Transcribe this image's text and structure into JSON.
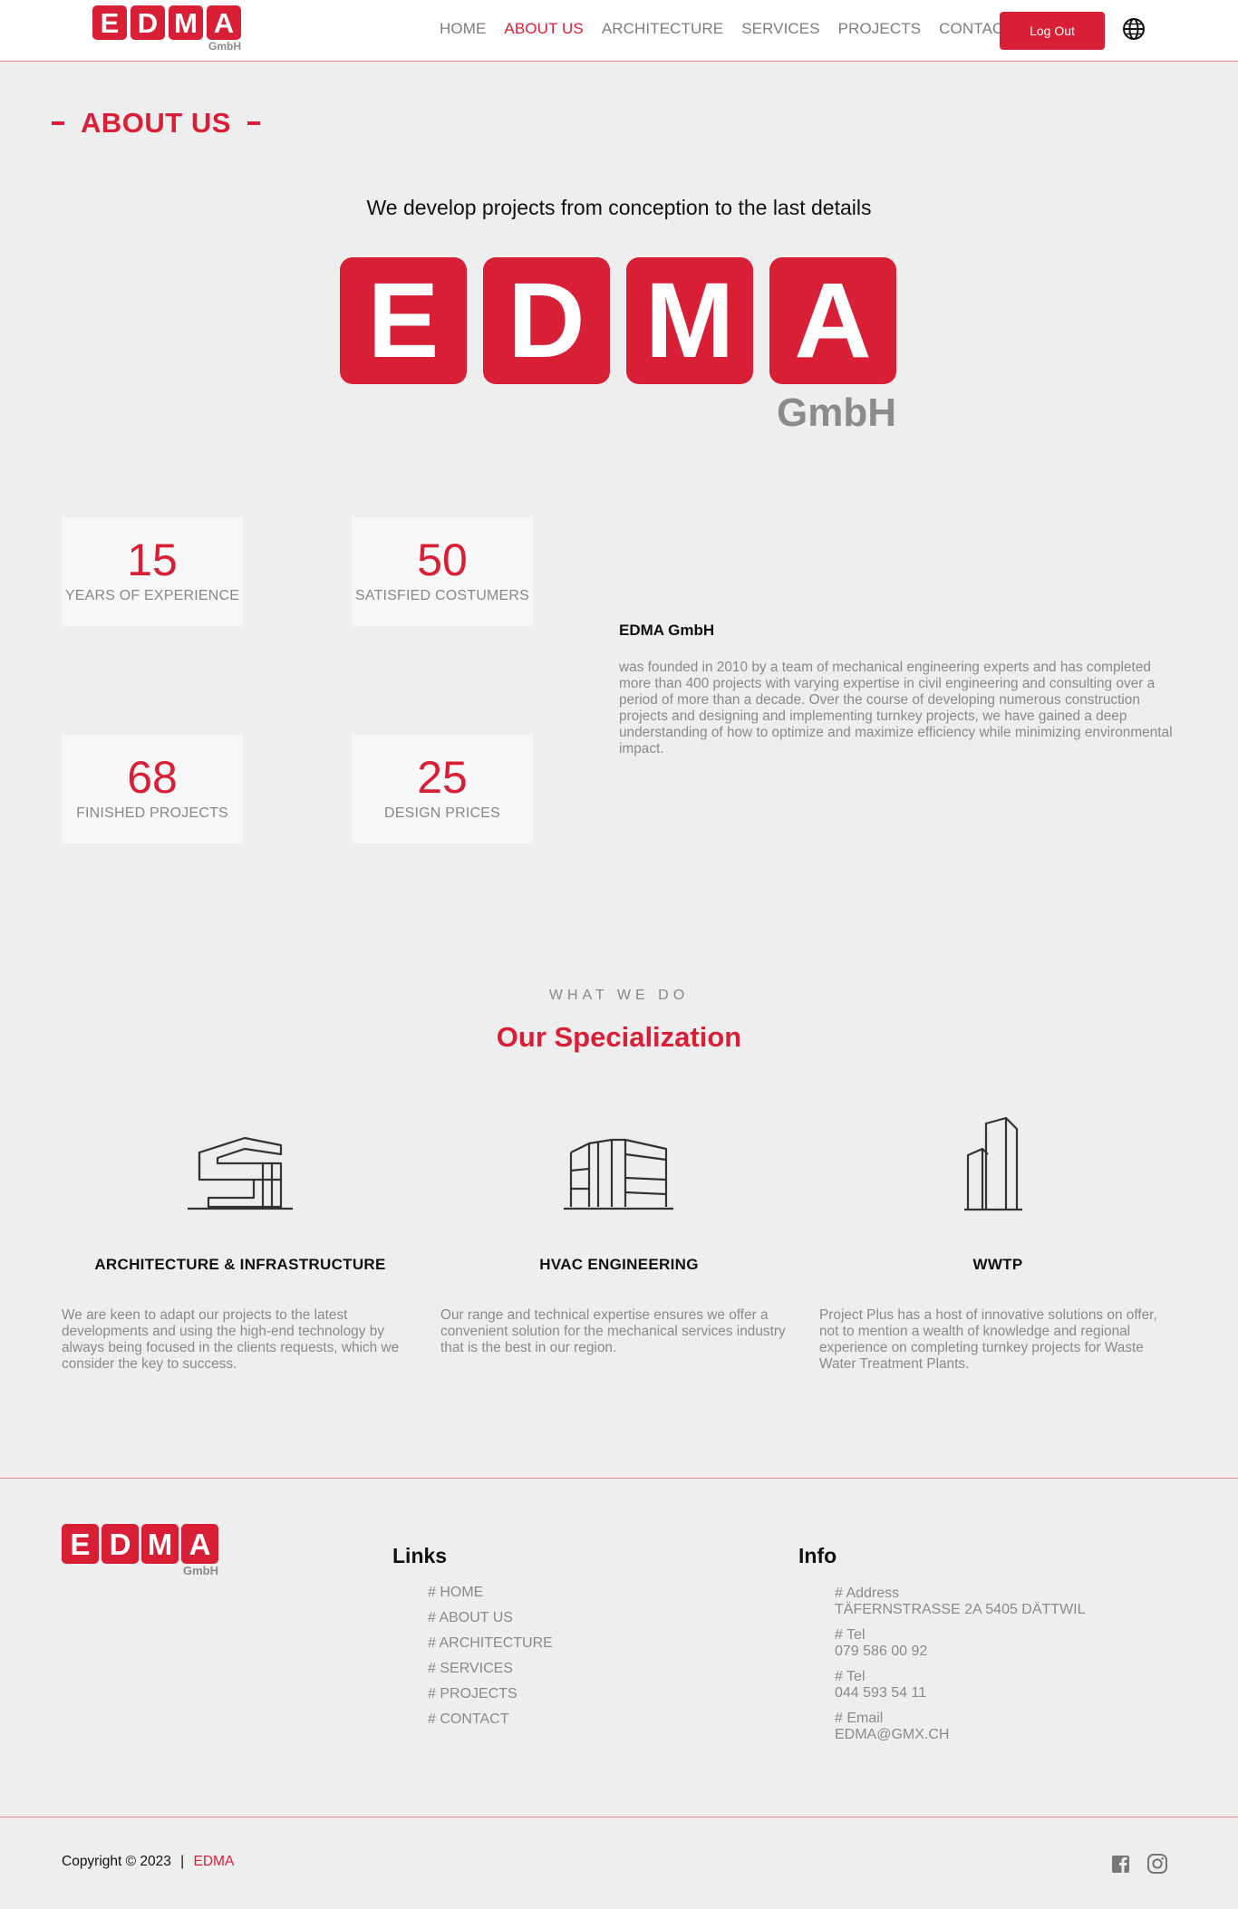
{
  "brand": {
    "letters": [
      "E",
      "D",
      "M",
      "A"
    ],
    "suffix": "GmbH",
    "accent": "#d81f35",
    "gray": "#8b8b8b"
  },
  "nav": {
    "items": [
      "HOME",
      "ABOUT US",
      "ARCHITECTURE",
      "SERVICES",
      "PROJECTS",
      "CONTACT"
    ],
    "active": "ABOUT US",
    "logout_label": "Log Out",
    "language_icon": "globe-icon"
  },
  "about": {
    "title": "ABOUT US",
    "tagline": "We develop projects from conception to the last details"
  },
  "stats": [
    {
      "value": "15",
      "label": "YEARS OF EXPERIENCE"
    },
    {
      "value": "50",
      "label": "SATISFIED COSTUMERS"
    },
    {
      "value": "68",
      "label": "FINISHED PROJECTS"
    },
    {
      "value": "25",
      "label": "DESIGN PRICES"
    }
  ],
  "company": {
    "name": "EDMA GmbH",
    "description": "was founded in 2010 by a team of mechanical engineering experts and has completed more than 400 projects with varying expertise in civil engineering and consulting over a period of more than a decade. Over the course of developing numerous construction projects and designing and implementing turnkey projects, we have gained a deep understanding of how to optimize and maximize efficiency while minimizing environmental impact."
  },
  "specialization": {
    "eyebrow": "WHAT WE DO",
    "title": "Our Specialization",
    "items": [
      {
        "icon": "building-infrastructure-icon",
        "title": "ARCHITECTURE & INFRASTRUCTURE",
        "text": "We are keen to adapt our projects to the latest developments and using the high-end technology by always being focused in the clients requests, which we consider the key to success."
      },
      {
        "icon": "hvac-building-icon",
        "title": "HVAC ENGINEERING",
        "text": "Our range and technical expertise ensures we offer a convenient solution for the mechanical services industry that is the best in our region."
      },
      {
        "icon": "towers-icon",
        "title": "WWTP",
        "text": "Project Plus has a host of innovative solutions on offer, not to mention a wealth of knowledge and regional experience on completing turnkey projects for Waste Water Treatment Plants."
      }
    ]
  },
  "footer": {
    "links_title": "Links",
    "links": [
      "# HOME",
      "# ABOUT US",
      "# ARCHITECTURE",
      "# SERVICES",
      "# PROJECTS",
      "# CONTACT"
    ],
    "info_title": "Info",
    "info": [
      {
        "label": "# Address",
        "value": "TÄFERNSTRASSE 2A 5405 DÄTTWIL"
      },
      {
        "label": "# Tel",
        "value": "079 586 00 92"
      },
      {
        "label": "# Tel",
        "value": "044 593 54 11"
      },
      {
        "label": "# Email",
        "value": "EDMA@GMX.CH"
      }
    ],
    "copyright": "Copyright © 2023",
    "separator": "|",
    "copyright_brand": "EDMA",
    "social": [
      "facebook-icon",
      "instagram-icon"
    ]
  }
}
